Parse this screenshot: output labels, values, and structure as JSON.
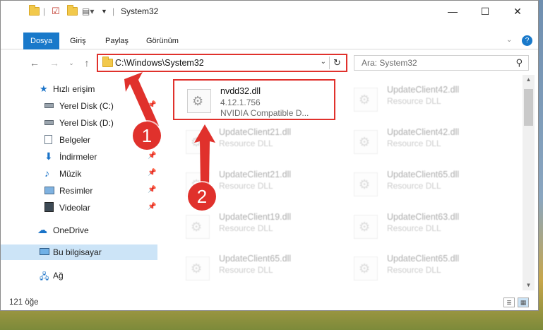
{
  "window": {
    "title": "System32",
    "controls": {
      "minimize": "—",
      "maximize": "☐",
      "close": "✕"
    }
  },
  "ribbon": {
    "tabs": [
      "Dosya",
      "Giriş",
      "Paylaş",
      "Görünüm"
    ],
    "help_icon": "?"
  },
  "nav": {
    "address": "C:\\Windows\\System32",
    "search_placeholder": "Ara: System32"
  },
  "sidebar": {
    "items": [
      {
        "label": "Hızlı erişim",
        "icon": "star-icon"
      },
      {
        "label": "Yerel Disk (C:)",
        "icon": "drive-icon"
      },
      {
        "label": "Yerel Disk (D:)",
        "icon": "drive-icon"
      },
      {
        "label": "Belgeler",
        "icon": "document-icon"
      },
      {
        "label": "İndirmeler",
        "icon": "download-icon"
      },
      {
        "label": "Müzik",
        "icon": "music-icon"
      },
      {
        "label": "Resimler",
        "icon": "picture-icon"
      },
      {
        "label": "Videolar",
        "icon": "video-icon"
      },
      {
        "label": "OneDrive",
        "icon": "cloud-icon"
      },
      {
        "label": "Bu bilgisayar",
        "icon": "computer-icon"
      },
      {
        "label": "Ağ",
        "icon": "network-icon"
      }
    ]
  },
  "files": {
    "highlighted": {
      "name": "nvdd32.dll",
      "version": "4.12.1.756",
      "description": "NVIDIA Compatible D..."
    },
    "faded": [
      {
        "name": "UpdateClient42.dll",
        "type": "Resource DLL"
      },
      {
        "name": "UpdateClient21.dll",
        "type": "Resource DLL"
      },
      {
        "name": "UpdateClient42.dll",
        "type": "Resource DLL"
      },
      {
        "name": "UpdateClient21.dll",
        "type": "Resource DLL"
      },
      {
        "name": "UpdateClient65.dll",
        "type": "Resource DLL"
      },
      {
        "name": "UpdateClient19.dll",
        "type": "Resource DLL"
      },
      {
        "name": "UpdateClient63.dll",
        "type": "Resource DLL"
      },
      {
        "name": "UpdateClient65.dll",
        "type": "Resource DLL"
      },
      {
        "name": "UpdateClient65.dll",
        "type": "Resource DLL"
      }
    ]
  },
  "status": {
    "count": "121 öğe"
  },
  "annotations": {
    "step1": "1",
    "step2": "2",
    "color": "#e0312c"
  }
}
